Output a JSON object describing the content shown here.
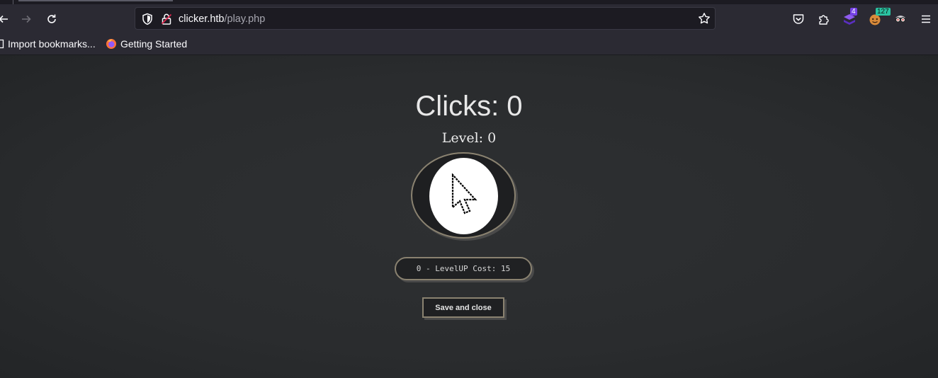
{
  "browser": {
    "url_host": "clicker.htb",
    "url_path": "/play.php",
    "badges": {
      "extension_purple": "4",
      "extension_green": "127"
    }
  },
  "bookmarks": [
    {
      "label": "Import bookmarks..."
    },
    {
      "label": "Getting Started"
    }
  ],
  "game": {
    "clicks_text": "Clicks: 0",
    "level_text": "Level: 0",
    "levelup_label": "0 - LevelUP Cost: 15",
    "save_label": "Save and close"
  },
  "colors": {
    "page_bg": "#2b2d30",
    "button_border": "#8a8270",
    "badge_purple": "#7542e5",
    "badge_green": "#2ac3a2"
  }
}
